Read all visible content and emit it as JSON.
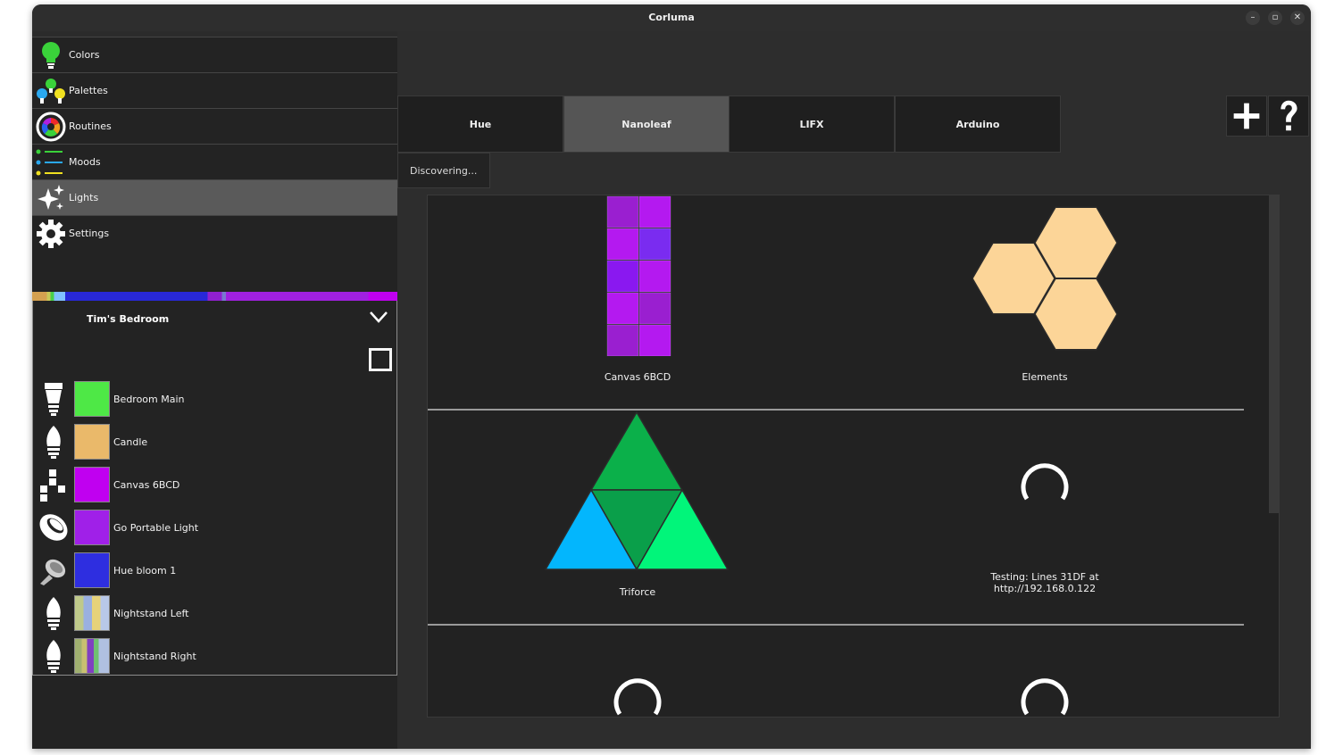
{
  "window": {
    "title": "Corluma",
    "minimize": "–",
    "maximize": "▫",
    "close": "✕"
  },
  "nav": [
    {
      "label": "Colors",
      "icon": "bulb-icon"
    },
    {
      "label": "Palettes",
      "icon": "palette-bulbs-icon"
    },
    {
      "label": "Routines",
      "icon": "color-wheel-icon"
    },
    {
      "label": "Moods",
      "icon": "moods-list-icon"
    },
    {
      "label": "Lights",
      "icon": "sparkle-icon",
      "active": true
    },
    {
      "label": "Settings",
      "icon": "gear-icon"
    }
  ],
  "group": {
    "title": "Tim's Bedroom",
    "lights": [
      {
        "name": "Bedroom Main",
        "icon": "spot-bulb-icon",
        "color": "#4ee846"
      },
      {
        "name": "Candle",
        "icon": "candle-bulb-icon",
        "color": "#eab96a"
      },
      {
        "name": "Canvas 6BCD",
        "icon": "canvas-panels-icon",
        "color": "#c000f0"
      },
      {
        "name": "Go Portable Light",
        "icon": "go-lamp-icon",
        "color": "#a020e8"
      },
      {
        "name": "Hue bloom 1",
        "icon": "bloom-lamp-icon",
        "color": "#2e2ee0"
      },
      {
        "name": "Nightstand Left",
        "icon": "candle-bulb-icon",
        "color": "#d8d890"
      },
      {
        "name": "Nightstand Right",
        "icon": "candle-bulb-icon",
        "color": "#a0b0a0"
      }
    ]
  },
  "tabs": [
    "Hue",
    "Nanoleaf",
    "LIFX",
    "Arduino"
  ],
  "active_tab": "Nanoleaf",
  "actions": {
    "add": "+",
    "help": "?"
  },
  "status": "Discovering...",
  "discovered": [
    {
      "caption": "Canvas 6BCD",
      "kind": "canvas"
    },
    {
      "caption": "Elements",
      "kind": "elements"
    },
    {
      "caption": "Triforce",
      "kind": "triforce"
    },
    {
      "caption": "Testing: Lines 31DF at\nhttp://192.168.0.122",
      "kind": "spinner"
    },
    {
      "caption": "",
      "kind": "spinner"
    },
    {
      "caption": "",
      "kind": "spinner"
    }
  ],
  "colors": {
    "canvas_tiles": [
      "#9a1fd0",
      "#b419f0",
      "#b419f0",
      "#7a2cf0",
      "#8a18f0",
      "#b419f0",
      "#b419f0",
      "#9a1fd0",
      "#9a1fd0",
      "#b419f0"
    ],
    "elements_fill": "#fcd598",
    "triforce": {
      "top": "#0bb04a",
      "center": "#0a9f4a",
      "left": "#03b6fd",
      "right": "#01f57a"
    }
  }
}
